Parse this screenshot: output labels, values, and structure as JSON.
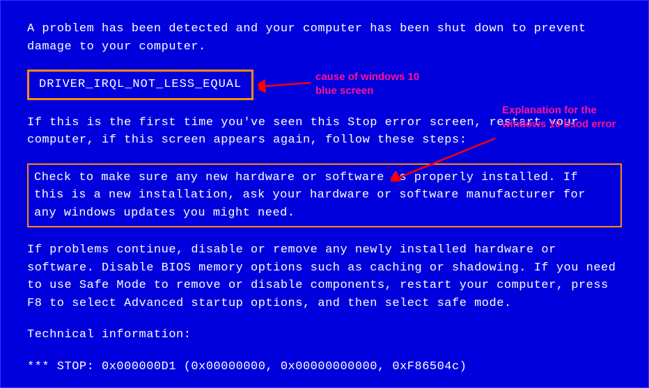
{
  "bsod": {
    "intro": "A problem has been detected and your computer has been shut down to prevent damage to your computer.",
    "error_code": "DRIVER_IRQL_NOT_LESS_EQUAL",
    "first_time": "If this is the first time you've seen this Stop error screen, restart your computer, if this screen appears again, follow these steps:",
    "check_hardware": "Check to make sure any new hardware or software is properly installed. If this is a new installation, ask your hardware or software manufacturer for any windows updates you might need.",
    "if_problems": "If problems continue, disable or remove any newly installed hardware or software. Disable BIOS memory options such as caching or shadowing. If you need to use Safe Mode to remove or disable components, restart your computer, press F8 to select Advanced startup options, and then select safe mode.",
    "technical_label": "Technical information:",
    "stop_line": "*** STOP: 0x000000D1 (0x00000000, 0x00000000000, 0xF86504c)"
  },
  "annotations": {
    "cause": "cause of windows 10 blue screen",
    "explanation": "Explanation for the windows 10 bsod error"
  },
  "colors": {
    "background": "#0000dd",
    "text": "#ffffff",
    "highlight_border": "#ff8c00",
    "annotation": "#ff1493",
    "arrow": "#ff0000"
  }
}
